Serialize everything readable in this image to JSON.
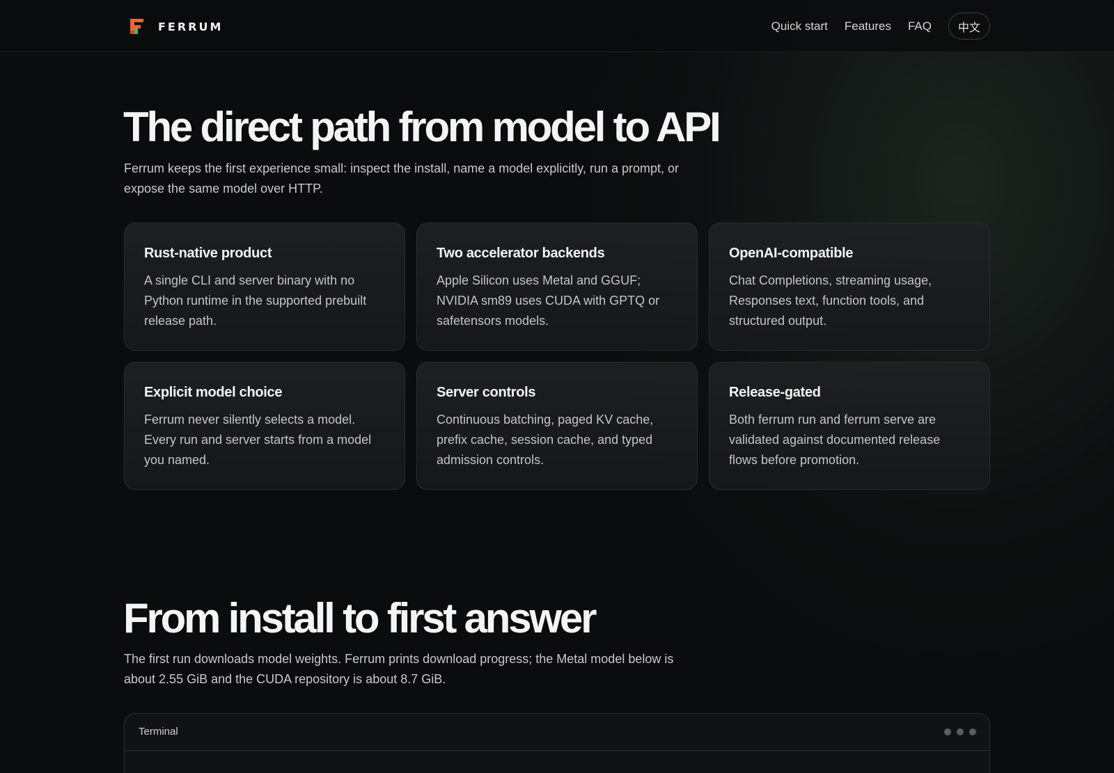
{
  "header": {
    "brand": "FERRUM",
    "nav": [
      "Quick start",
      "Features",
      "FAQ"
    ],
    "lang_label": "中文"
  },
  "hero": {
    "title": "The direct path from model to API",
    "subtitle": "Ferrum keeps the first experience small: inspect the install, name a model explicitly, run a prompt, or expose the same model over HTTP."
  },
  "features": [
    {
      "title": "Rust-native product",
      "description": "A single CLI and server binary with no Python runtime in the supported prebuilt release path."
    },
    {
      "title": "Two accelerator backends",
      "description": "Apple Silicon uses Metal and GGUF; NVIDIA sm89 uses CUDA with GPTQ or safetensors models."
    },
    {
      "title": "OpenAI-compatible",
      "description": "Chat Completions, streaming usage, Responses text, function tools, and structured output."
    },
    {
      "title": "Explicit model choice",
      "description": "Ferrum never silently selects a model. Every run and server starts from a model you named."
    },
    {
      "title": "Server controls",
      "description": "Continuous batching, paged KV cache, prefix cache, session cache, and typed admission controls."
    },
    {
      "title": "Release-gated",
      "description": "Both ferrum run and ferrum serve are validated against documented release flows before promotion."
    }
  ],
  "install_section": {
    "title": "From install to first answer",
    "subtitle": "The first run downloads model weights. Ferrum prints download progress; the Metal model below is about 2.55 GiB and the CUDA repository is about 8.7 GiB."
  },
  "terminal": {
    "label": "Terminal"
  },
  "colors": {
    "background": "#0b0c0d",
    "logo_orange": "#f0642d",
    "logo_green": "#3fb97a",
    "card_border": "#2a2c2f"
  }
}
